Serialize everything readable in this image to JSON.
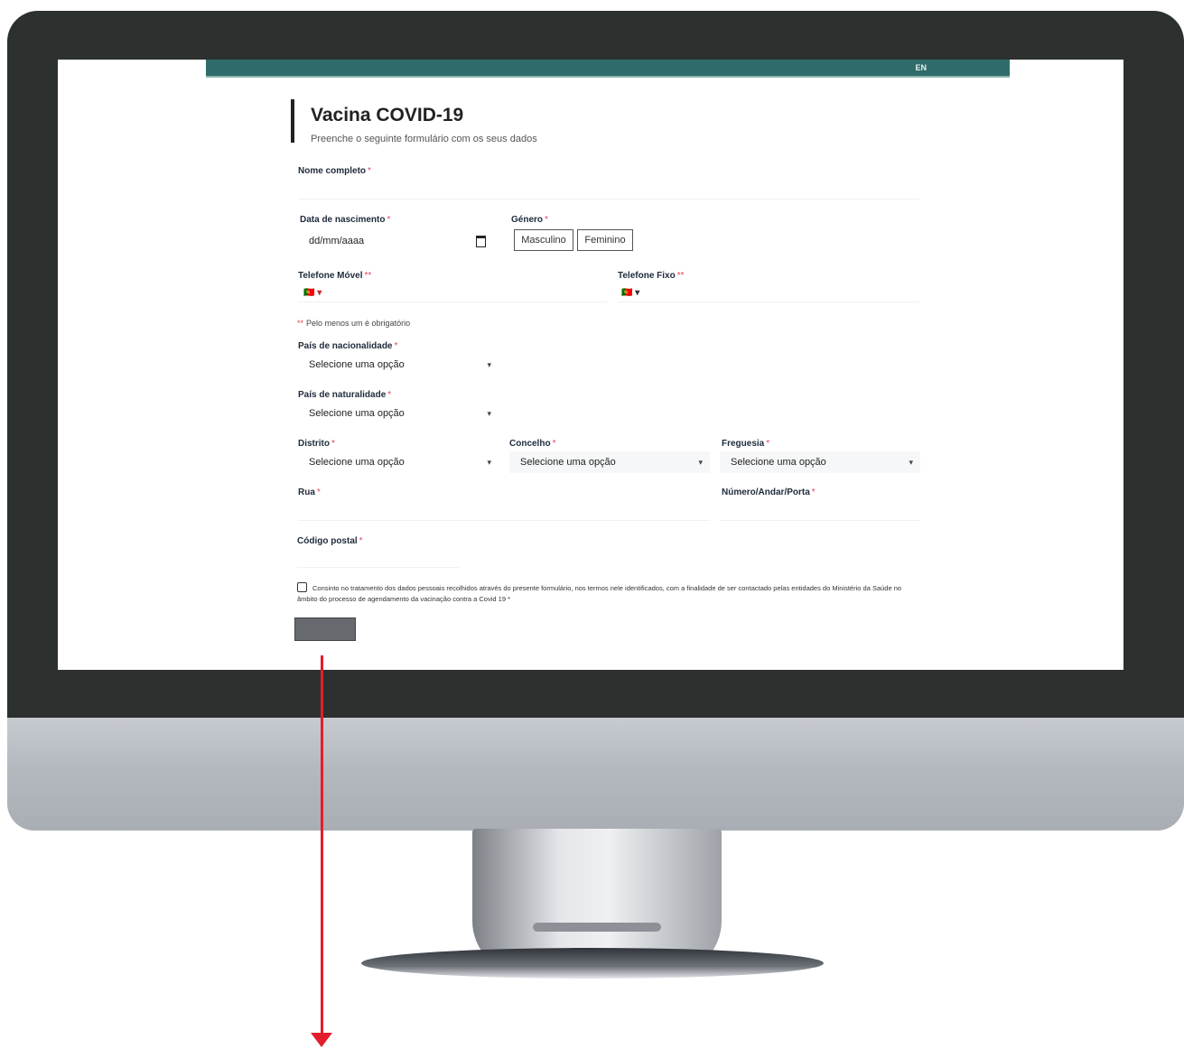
{
  "header": {
    "language_label": "EN"
  },
  "form": {
    "title": "Vacina COVID-19",
    "subtitle": "Preenche o seguinte formulário com os seus dados",
    "required_mark": "*",
    "full_name": {
      "label": "Nome completo"
    },
    "birth_date": {
      "label": "Data de nascimento",
      "placeholder": "dd/mm/aaaa"
    },
    "gender": {
      "label": "Género",
      "options": [
        "Masculino",
        "Feminino"
      ]
    },
    "mobile_phone": {
      "label": "Telefone Móvel",
      "required_mark": "**",
      "country": "🇵🇹 ▾"
    },
    "landline_phone": {
      "label": "Telefone Fixo",
      "required_mark": "**",
      "country": "🇵🇹 ▾"
    },
    "phone_note": {
      "mark": "**",
      "text": "Pelo menos um é obrigatório"
    },
    "nationality": {
      "label": "País de nacionalidade",
      "value": "Selecione uma opção"
    },
    "birth_country": {
      "label": "País de naturalidade",
      "value": "Selecione uma opção"
    },
    "district": {
      "label": "Distrito",
      "value": "Selecione uma opção"
    },
    "county": {
      "label": "Concelho",
      "value": "Selecione uma opção"
    },
    "parish": {
      "label": "Freguesia",
      "value": "Selecione uma opção"
    },
    "street": {
      "label": "Rua"
    },
    "number_floor_door": {
      "label": "Número/Andar/Porta"
    },
    "postal_code": {
      "label": "Código postal"
    },
    "consent_text": "Consinto no tratamento dos dados pessoais recolhidos através do presente formulário, nos termos nele identificados, com a finalidade de ser contactado pelas entidades do Ministério da Saúde no âmbito do processo de agendamento da vacinação contra a Covid 19 *"
  },
  "icons": {
    "calendar": "calendar-icon",
    "chevron": "chevron-down-icon",
    "arrow": "annotation-arrow"
  },
  "colors": {
    "header": "#2f6c69",
    "required": "#e0465b",
    "annotation_arrow": "#e31d2b"
  }
}
